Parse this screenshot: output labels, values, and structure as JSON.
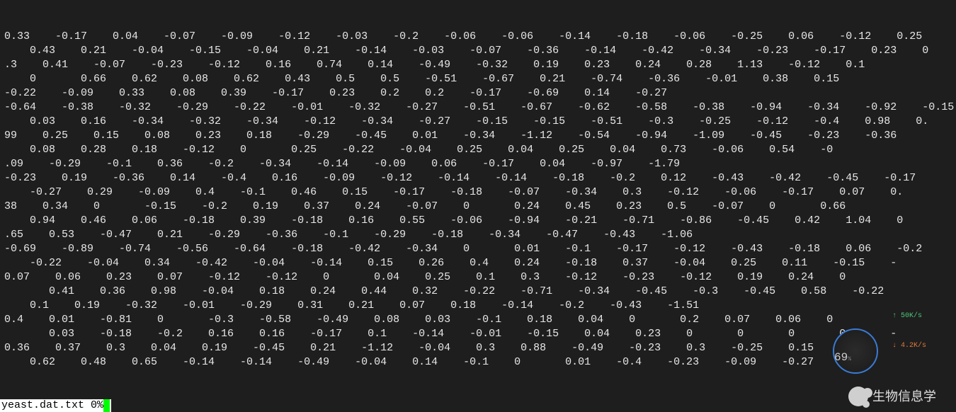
{
  "terminal": {
    "rows": [
      "0.33    -0.17    0.04    -0.07    -0.09    -0.12    -0.03    -0.2    -0.06    -0.06    -0.14    -0.18    -0.06    -0.25    0.06    -0.12    0.25",
      "    0.43    0.21    -0.04    -0.15    -0.04    0.21    -0.14    -0.03    -0.07    -0.36    -0.14    -0.42    -0.34    -0.23    -0.17    0.23    0",
      ".3    0.41    -0.07    -0.23    -0.12    0.16    0.74    0.14    -0.49    -0.32    0.19    0.23    0.24    0.28    1.13    -0.12    0.1",
      "    0       0.66    0.62    0.08    0.62    0.43    0.5    0.5    -0.51    -0.67    0.21    -0.74    -0.36    -0.01    0.38    0.15",
      "-0.22    -0.09    0.33    0.08    0.39    -0.17    0.23    0.2    0.2    -0.17    -0.69    0.14    -0.27",
      "-0.64    -0.38    -0.32    -0.29    -0.22    -0.01    -0.32    -0.27    -0.51    -0.67    -0.62    -0.58    -0.38    -0.94    -0.34    -0.92    -0.15",
      "    0.03    0.16    -0.34    -0.32    -0.34    -0.12    -0.34    -0.27    -0.15    -0.15    -0.51    -0.3    -0.25    -0.12    -0.4    0.98    0.",
      "99    0.25    0.15    0.08    0.23    0.18    -0.29    -0.45    0.01    -0.34    -1.12    -0.54    -0.94    -1.09    -0.45    -0.23    -0.36",
      "    0.08    0.28    0.18    -0.12    0       0.25    -0.22    -0.04    0.25    0.04    0.25    0.04    0.73    -0.06    0.54    -0",
      ".09    -0.29    -0.1    0.36    -0.2    -0.34    -0.14    -0.09    0.06    -0.17    0.04    -0.97    -1.79",
      "-0.23    0.19    -0.36    0.14    -0.4    0.16    -0.09    -0.12    -0.14    -0.14    -0.18    -0.2    0.12    -0.43    -0.42    -0.45    -0.17",
      "    -0.27    0.29    -0.09    0.4    -0.1    0.46    0.15    -0.17    -0.18    -0.07    -0.34    0.3    -0.12    -0.06    -0.17    0.07    0.",
      "38    0.34    0       -0.15    -0.2    0.19    0.37    0.24    -0.07    0       0.24    0.45    0.23    0.5    -0.07    0       0.66",
      "    0.94    0.46    0.06    -0.18    0.39    -0.18    0.16    0.55    -0.06    -0.94    -0.21    -0.71    -0.86    -0.45    0.42    1.04    0",
      ".65    0.53    -0.47    0.21    -0.29    -0.36    -0.1    -0.29    -0.18    -0.34    -0.47    -0.43    -1.06",
      "-0.69    -0.89    -0.74    -0.56    -0.64    -0.18    -0.42    -0.34    0       0.01    -0.1    -0.17    -0.12    -0.43    -0.18    0.06    -0.2",
      "    -0.22    -0.04    0.34    -0.42    -0.04    -0.14    0.15    0.26    0.4    0.24    -0.18    0.37    -0.04    0.25    0.11    -0.15    -",
      "0.07    0.06    0.23    0.07    -0.12    -0.12    0       0.04    0.25    0.1    0.3    -0.12    -0.23    -0.12    0.19    0.24    0",
      "       0.41    0.36    0.98    -0.04    0.18    0.24    0.44    0.32    -0.22    -0.71    -0.34    -0.45    -0.3    -0.45    0.58    -0.22",
      "    0.1    0.19    -0.32    -0.01    -0.29    0.31    0.21    0.07    0.18    -0.14    -0.2    -0.43    -1.51",
      "0.4    0.01    -0.81    0       -0.3    -0.58    -0.49    0.08    0.03    -0.1    0.18    0.04    0       0.2    0.07    0.06    0",
      "       0.03    -0.18    -0.2    0.16    0.16    -0.17    0.1    -0.14    -0.01    -0.15    0.04    0.23    0       0       0       0       -",
      "0.36    0.37    0.3    0.04    0.19    -0.45    0.21    -1.12    -0.04    0.3    0.88    -0.49    -0.23    0.3    -0.25    0.15    0.52",
      "    0.62    0.48    0.65    -0.14    -0.14    -0.49    -0.04    0.14    -0.1    0       0.01    -0.4    -0.23    -0.09    -0.27    0"
    ]
  },
  "status": {
    "filename": "yeast.dat.txt",
    "position": "0%"
  },
  "network_widget": {
    "percent": "69",
    "percent_suffix": "%",
    "up_rate": "50K/s",
    "down_rate": "4.2K/s"
  },
  "watermark": {
    "text": "生物信息学"
  }
}
